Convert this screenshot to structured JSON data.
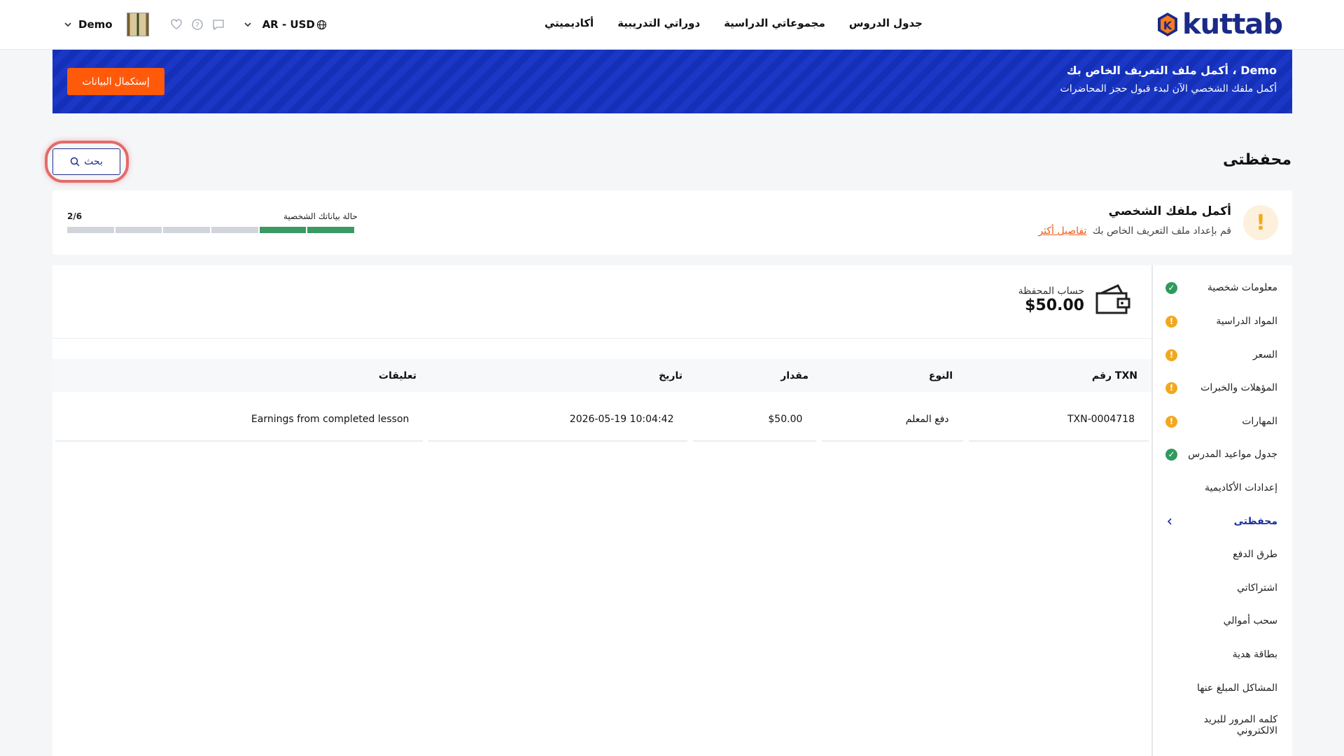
{
  "header": {
    "logo_text": "kuttab",
    "nav": [
      "جدول الدروس",
      "مجموعاتي الدراسية",
      "دوراتي التدريبية",
      "أكاديميتي"
    ],
    "currency": "AR - USD",
    "user_name": "Demo"
  },
  "banner": {
    "title": "أكمل ملف التعريف الخاص بك ، Demo",
    "subtitle": "أكمل ملفك الشخصي الآن لبدء قبول حجز المحاضرات",
    "button": "إستكمال البيانات"
  },
  "page": {
    "title": "محفظتى",
    "search_label": "بحث"
  },
  "profile": {
    "title": "أكمل ملفك الشخصي",
    "subtitle": "قم بإعداد ملف التعريف الخاص بك",
    "link": "تفاصيل أكثر",
    "progress_label": "حالة بياناتك الشخصية",
    "progress_text": "2/6",
    "progress_done": 2,
    "progress_total": 6
  },
  "wallet": {
    "label": "حساب المحفظة",
    "amount": "$50.00"
  },
  "table": {
    "headers": [
      "رقم TXN",
      "النوع",
      "مقدار",
      "تاريخ",
      "تعليقات"
    ],
    "rows": [
      [
        "TXN-0004718",
        "دفع المعلم",
        "$50.00",
        "2026-05-19 10:04:42",
        "Earnings from completed lesson"
      ]
    ]
  },
  "sidebar": {
    "items": [
      {
        "label": "معلومات شخصية",
        "status": "ok"
      },
      {
        "label": "المواد الدراسية",
        "status": "warn"
      },
      {
        "label": "السعر",
        "status": "warn"
      },
      {
        "label": "المؤهلات والخبرات",
        "status": "warn"
      },
      {
        "label": "المهارات",
        "status": "warn"
      },
      {
        "label": "جدول مواعيد المدرس",
        "status": "ok"
      },
      {
        "label": "إعدادات الأكاديمية",
        "status": ""
      },
      {
        "label": "محفظتى",
        "status": "active"
      },
      {
        "label": "طرق الدفع",
        "status": ""
      },
      {
        "label": "اشتراكاتي",
        "status": ""
      },
      {
        "label": "سحب أموالي",
        "status": ""
      },
      {
        "label": "بطاقة هدية",
        "status": ""
      },
      {
        "label": "المشاكل المبلغ عنها",
        "status": ""
      },
      {
        "label": "كلمه المرور للبريد الالكتروني",
        "status": ""
      }
    ]
  }
}
